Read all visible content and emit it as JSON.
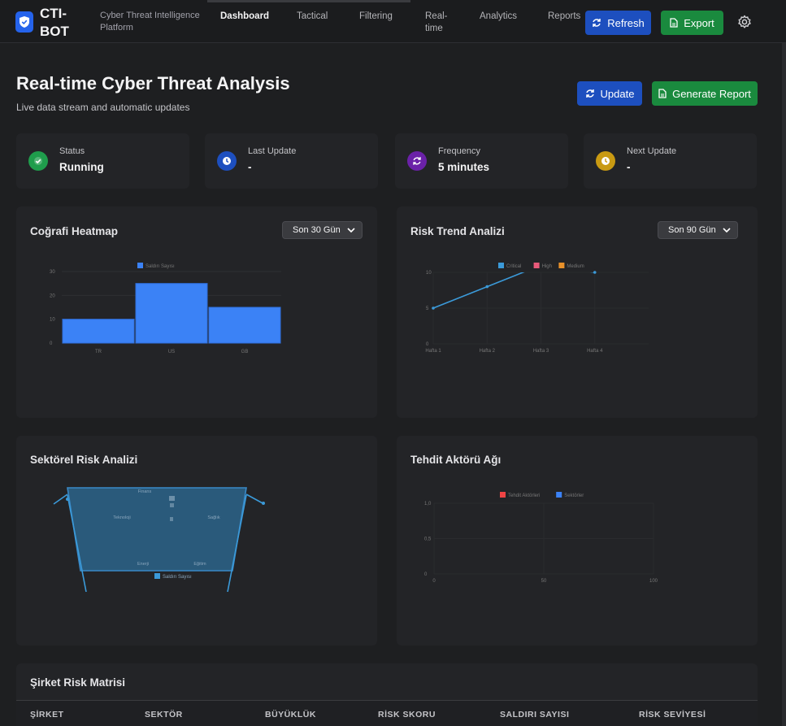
{
  "brand": {
    "name": "CTI-BOT",
    "subtitle": "Cyber Threat Intelligence Platform"
  },
  "nav": {
    "items": [
      {
        "label": "Dashboard",
        "active": true
      },
      {
        "label": "Tactical"
      },
      {
        "label": "Filtering"
      },
      {
        "label": "Real-time"
      },
      {
        "label": "Analytics"
      },
      {
        "label": "Reports"
      }
    ],
    "refresh_label": "Refresh",
    "export_label": "Export"
  },
  "header": {
    "title": "Real-time Cyber Threat Analysis",
    "subtitle": "Live data stream and automatic updates",
    "update_label": "Update",
    "report_label": "Generate Report"
  },
  "stats": [
    {
      "label": "Status",
      "value": "Running",
      "icon": "check-circle-icon",
      "color": "#1f9d4c"
    },
    {
      "label": "Last Update",
      "value": "-",
      "icon": "clock-icon",
      "color": "#1d4fbf"
    },
    {
      "label": "Frequency",
      "value": "5 minutes",
      "icon": "sync-icon",
      "color": "#6b21a8"
    },
    {
      "label": "Next Update",
      "value": "-",
      "icon": "clock-icon",
      "color": "#c99a12"
    }
  ],
  "panels": {
    "heatmap": {
      "title": "Coğrafi Heatmap",
      "select": "Son 30 Gün"
    },
    "risk_trend": {
      "title": "Risk Trend Analizi",
      "select": "Son 90 Gün"
    },
    "sector": {
      "title": "Sektörel Risk Analizi"
    },
    "actor": {
      "title": "Tehdit Aktörü Ağı"
    }
  },
  "chart_data": [
    {
      "type": "bar",
      "categories": [
        "TR",
        "US",
        "GB"
      ],
      "series": [
        {
          "name": "Saldırı Sayısı",
          "values": [
            10,
            25,
            15
          ]
        }
      ],
      "ylim": [
        0,
        30
      ],
      "yticks": [
        "0",
        "10",
        "20",
        "30"
      ],
      "legend": "top-center",
      "color": "#3b82f6"
    },
    {
      "type": "line",
      "categories": [
        "Hafta 1",
        "Hafta 2",
        "Hafta 3",
        "Hafta 4"
      ],
      "series": [
        {
          "name": "Critical",
          "values": [
            5,
            8,
            11,
            10
          ],
          "color": "#3b9ad9"
        },
        {
          "name": "High",
          "values": [],
          "color": "#e85a7a"
        },
        {
          "name": "Medium",
          "values": [],
          "color": "#e8912a"
        }
      ],
      "ylim": [
        0,
        10
      ],
      "yticks": [
        "0",
        "5",
        "10"
      ],
      "legend": "top-center"
    },
    {
      "type": "radar",
      "axes": [
        "Finans",
        "Sağlık",
        "Eğitim",
        "Teknoloji",
        "Enerji"
      ],
      "series": [
        {
          "name": "Saldırı Sayısı",
          "color": "#3b9ad9"
        }
      ],
      "tick_labels": [
        "",
        "",
        ""
      ],
      "legend": "bottom-center"
    },
    {
      "type": "scatter",
      "series": [
        {
          "name": "Tehdit Aktörleri",
          "color": "#ef4444",
          "values": []
        },
        {
          "name": "Sektörler",
          "color": "#3b82f6",
          "values": []
        }
      ],
      "xticks": [
        "0",
        "50",
        "100"
      ],
      "yticks": [
        "0",
        "0,5",
        "1,0"
      ],
      "legend": "top-center"
    }
  ],
  "table": {
    "title": "Şirket Risk Matrisi",
    "columns": [
      "ŞİRKET",
      "SEKTÖR",
      "BÜYÜKLÜK",
      "RİSK SKORU",
      "SALDIRI SAYISI",
      "RİSK SEVİYESİ"
    ]
  }
}
